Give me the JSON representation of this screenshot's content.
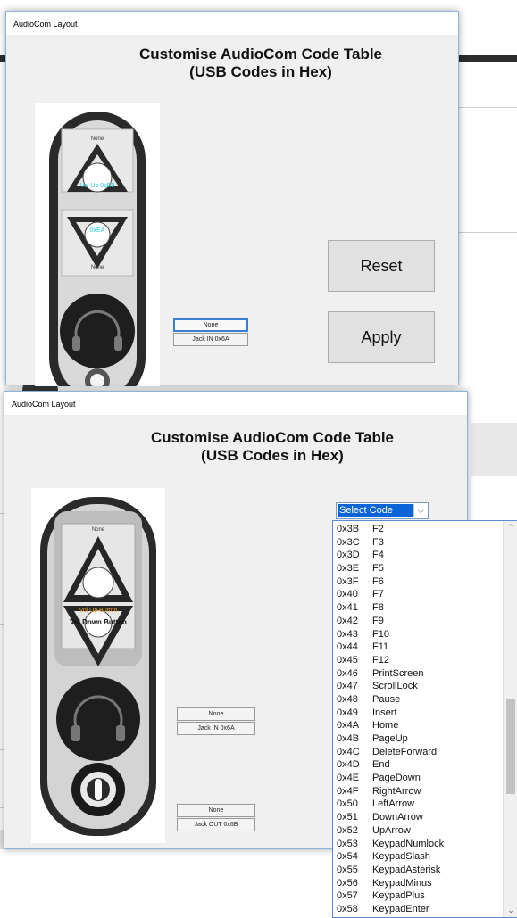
{
  "windows": [
    {
      "title": "AudioCom Layout",
      "heading_line1": "Customise AudioCom  Code Table",
      "heading_line2": "(USB Codes in Hex)",
      "device": {
        "top_label": "None",
        "up_label": "Vol Up 0xE9",
        "down_label": "0xEA",
        "bottom_label": "None"
      },
      "jack_in": {
        "value": "None",
        "label": "Jack IN  0x6A"
      },
      "reset_label": "Reset",
      "apply_label": "Apply"
    },
    {
      "title": "AudioCom Layout",
      "heading_line1": "Customise AudioCom  Code Table",
      "heading_line2": "(USB Codes in Hex)",
      "device": {
        "top_label": "None",
        "up_label": "Vol Up Button",
        "down_label": "Vol Down Button",
        "bottom_label": "None"
      },
      "jack_in": {
        "value": "None",
        "label": "Jack IN  0x6A"
      },
      "jack_out": {
        "value": "None",
        "label": "Jack OUT  0x6B"
      },
      "select_code": {
        "selected": "Select Code",
        "options": [
          {
            "code": "0x3B",
            "key": "F2"
          },
          {
            "code": "0x3C",
            "key": "F3"
          },
          {
            "code": "0x3D",
            "key": "F4"
          },
          {
            "code": "0x3E",
            "key": "F5"
          },
          {
            "code": "0x3F",
            "key": "F6"
          },
          {
            "code": "0x40",
            "key": "F7"
          },
          {
            "code": "0x41",
            "key": "F8"
          },
          {
            "code": "0x42",
            "key": "F9"
          },
          {
            "code": "0x43",
            "key": "F10"
          },
          {
            "code": "0x44",
            "key": "F11"
          },
          {
            "code": "0x45",
            "key": "F12"
          },
          {
            "code": "0x46",
            "key": "PrintScreen"
          },
          {
            "code": "0x47",
            "key": "ScrollLock"
          },
          {
            "code": "0x48",
            "key": "Pause"
          },
          {
            "code": "0x49",
            "key": "Insert"
          },
          {
            "code": "0x4A",
            "key": "Home"
          },
          {
            "code": "0x4B",
            "key": "PageUp"
          },
          {
            "code": "0x4C",
            "key": "DeleteForward"
          },
          {
            "code": "0x4D",
            "key": "End"
          },
          {
            "code": "0x4E",
            "key": "PageDown"
          },
          {
            "code": "0x4F",
            "key": "RightArrow"
          },
          {
            "code": "0x50",
            "key": "LeftArrow"
          },
          {
            "code": "0x51",
            "key": "DownArrow"
          },
          {
            "code": "0x52",
            "key": "UpArrow"
          },
          {
            "code": "0x53",
            "key": "KeypadNumlock"
          },
          {
            "code": "0x54",
            "key": "KeypadSlash"
          },
          {
            "code": "0x55",
            "key": "KeypadAsterisk"
          },
          {
            "code": "0x56",
            "key": "KeypadMinus"
          },
          {
            "code": "0x57",
            "key": "KeypadPlus"
          },
          {
            "code": "0x58",
            "key": "KeypadEnter"
          }
        ]
      }
    }
  ],
  "colors": {
    "selection": "#0a64d8",
    "window_border": "#8fb4d9",
    "up_label_w1": "#28c8e8",
    "up_label_w2": "#e8a020"
  },
  "icons": [
    "headset-icon",
    "chevron-down-icon",
    "triangle-up-icon",
    "triangle-down-icon",
    "knob-icon"
  ]
}
